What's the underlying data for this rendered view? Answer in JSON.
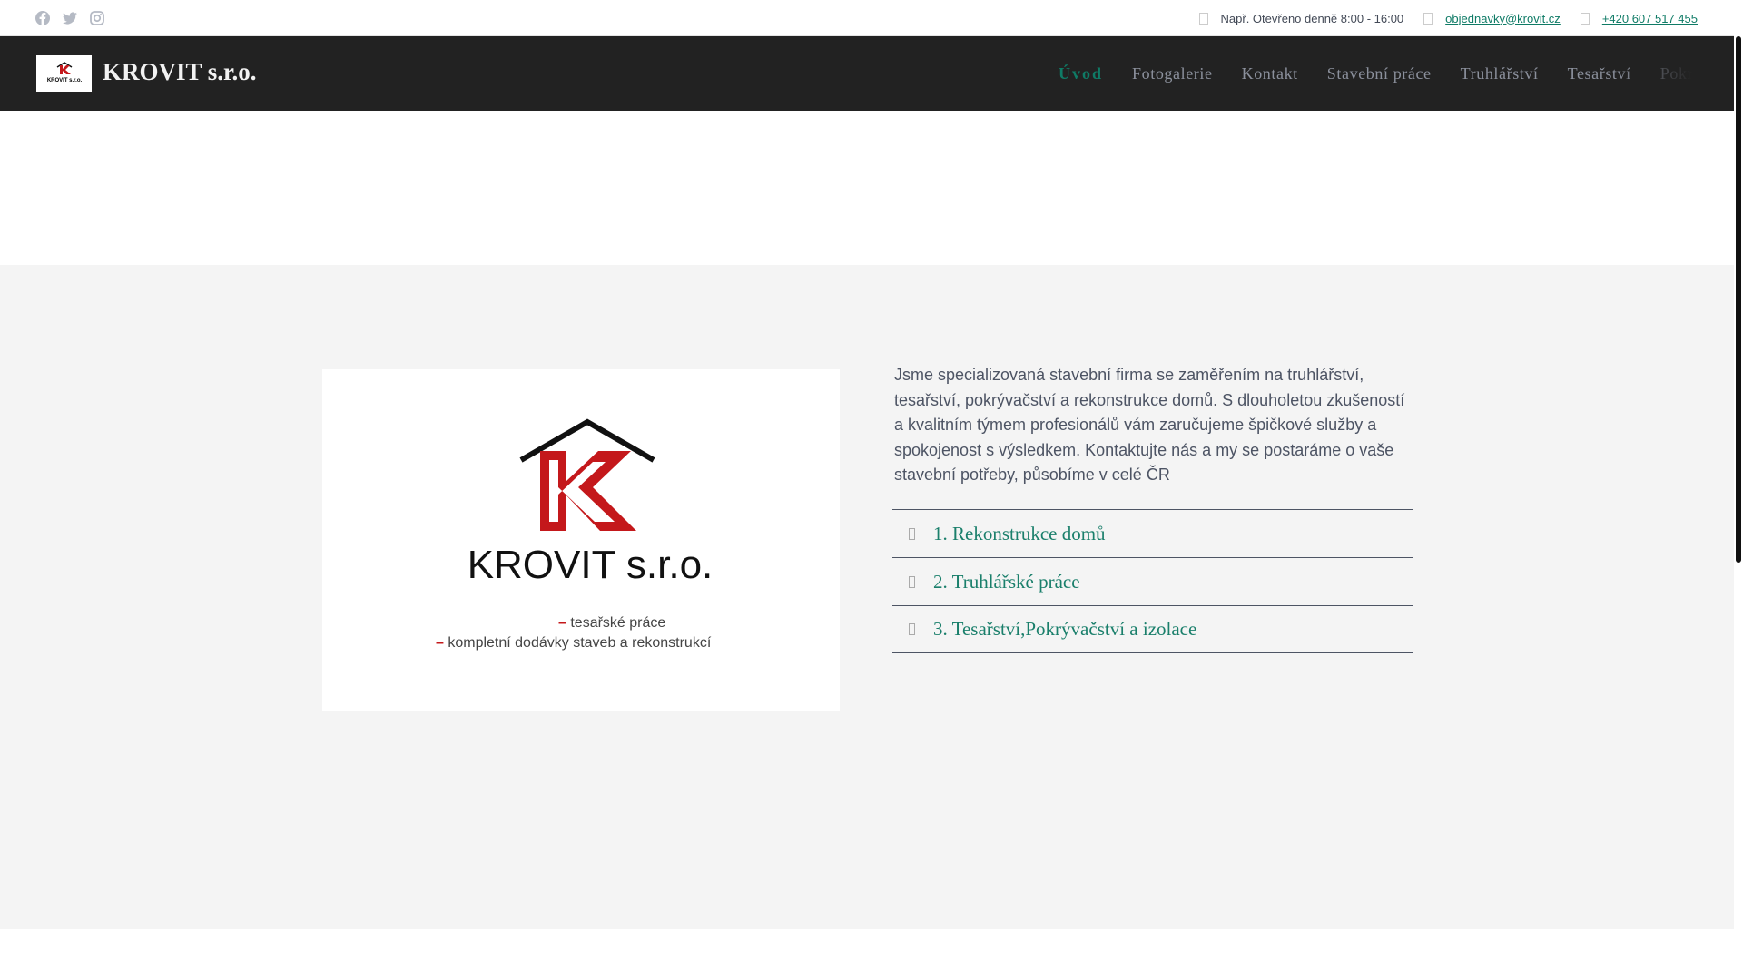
{
  "topbar": {
    "social": [
      "facebook-icon",
      "twitter-icon",
      "instagram-icon"
    ],
    "hours": "Např. Otevřeno denně 8:00 - 16:00",
    "email": "objednavky@krovit.cz",
    "phone": "+420 607 517 455"
  },
  "header": {
    "brand": "KROVIT s.r.o.",
    "nav": [
      "Úvod",
      "Fotogalerie",
      "Kontakt",
      "Stavební práce",
      "Truhlářství",
      "Tesařství",
      "Pokrývačství"
    ]
  },
  "logo": {
    "name": "KROVIT s.r.o.",
    "line1": "tesařské práce",
    "line2": "kompletní dodávky staveb a rekonstrukcí"
  },
  "main": {
    "intro": "Jsme specializovaná stavební firma se zaměřením na truhlářství, tesařství, pokrývačství a rekonstrukce domů. S dlouholetou zkušeností a kvalitním týmem profesionálů vám zaručujeme špičkové služby a spokojenost s výsledkem. Kontaktujte nás a my se postaráme o vaše stavební potřeby, působíme v celé ČR",
    "accordion": [
      "1. Rekonstrukce domů",
      "2. Truhlářské práce",
      "3. Tesařství,Pokrývačství a izolace"
    ]
  },
  "colors": {
    "accent": "#0f7b66",
    "header": "#222222",
    "section": "#f4f4f4",
    "logo_red": "#c4181b"
  }
}
